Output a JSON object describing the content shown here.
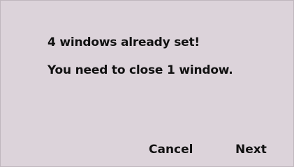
{
  "dialog": {
    "message_line1": "4 windows already set!",
    "message_line2": "You need to close 1 window.",
    "cancel_label": "Cancel",
    "next_label": "Next"
  },
  "colors": {
    "background": "#dcd3da",
    "text": "#111111"
  }
}
